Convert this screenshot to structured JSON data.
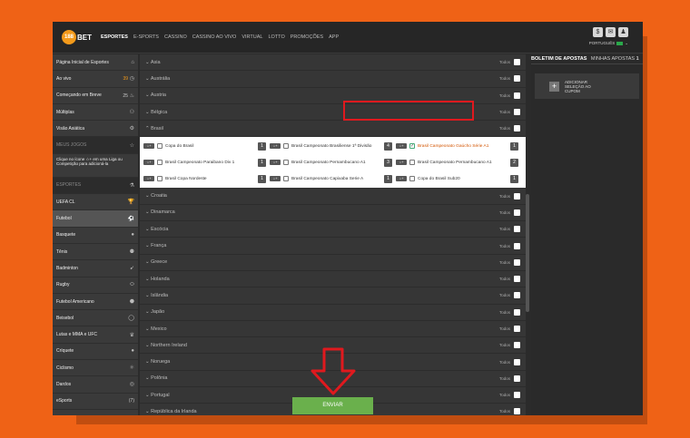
{
  "logo": {
    "number": "188",
    "word": "BET"
  },
  "nav": [
    "ESPORTES",
    "E-SPORTS",
    "CASSINO",
    "CASSINO AO VIVO",
    "VIRTUAL",
    "LOTTO",
    "PROMOÇÕES",
    "APP"
  ],
  "header": {
    "language": "PORTUGUÊS"
  },
  "sidebar": [
    {
      "label": "Página Inicial de Esportes",
      "count": "",
      "type": "item"
    },
    {
      "label": "Ao vivo",
      "count": "39",
      "type": "item",
      "orange": true
    },
    {
      "label": "Começando em Breve",
      "count": "25",
      "type": "item"
    },
    {
      "label": "Múltiplas",
      "count": "",
      "type": "item"
    },
    {
      "label": "Visão Asiática",
      "count": "",
      "type": "item"
    },
    {
      "label": "MEUS JOGOS",
      "count": "",
      "type": "hdr"
    },
    {
      "label": "Clique no ícone ☆+ em uma Liga ou Competição para adicioná-la",
      "count": "",
      "type": "tall"
    },
    {
      "label": "ESPORTES",
      "count": "",
      "type": "hdr"
    },
    {
      "label": "UEFA CL",
      "count": "",
      "type": "item"
    },
    {
      "label": "Futebol",
      "count": "",
      "type": "item",
      "hl": true
    },
    {
      "label": "Basquete",
      "count": "",
      "type": "item"
    },
    {
      "label": "Tênis",
      "count": "",
      "type": "item"
    },
    {
      "label": "Badminton",
      "count": "",
      "type": "item"
    },
    {
      "label": "Rugby",
      "count": "",
      "type": "item"
    },
    {
      "label": "Futebol Americano",
      "count": "",
      "type": "item"
    },
    {
      "label": "Beisebol",
      "count": "",
      "type": "item"
    },
    {
      "label": "Lutas e MMA e UFC",
      "count": "",
      "type": "item"
    },
    {
      "label": "Críquete",
      "count": "",
      "type": "item"
    },
    {
      "label": "Ciclismo",
      "count": "",
      "type": "item"
    },
    {
      "label": "Dardos",
      "count": "",
      "type": "item"
    },
    {
      "label": "eSports",
      "count": "(7)",
      "type": "item"
    }
  ],
  "countries_top": [
    "Asia",
    "Austrália",
    "Austria",
    "Bélgica",
    "Brasil"
  ],
  "countries_bottom": [
    "Croatia",
    "Dinamarca",
    "Escócia",
    "França",
    "Greece",
    "Holanda",
    "Islândia",
    "Japão",
    "Mexico",
    "Northern Ireland",
    "Noruega",
    "Polônia",
    "Portugal",
    "República da Irlanda"
  ],
  "todos_label": "Todos",
  "competitions": [
    {
      "name": "Copa do Brasil",
      "num": "1",
      "selected": false
    },
    {
      "name": "Brasil Campeonato Brasiliense 1ª Divisão",
      "num": "4",
      "selected": false
    },
    {
      "name": "Brasil Campeonato Gaúcho Série A1",
      "num": "1",
      "selected": true
    },
    {
      "name": "Brasil Campeonato Paraibano Div 1",
      "num": "1",
      "selected": false
    },
    {
      "name": "Brasil Campeonato Pernambucano A1",
      "num": "3",
      "selected": false
    },
    {
      "name": "Brasil Campeonato Pernambucano A1",
      "num": "2",
      "selected": false
    },
    {
      "name": "Brasil Copa Nordeste",
      "num": "1",
      "selected": false
    },
    {
      "name": "Brasil Campeonato Capixaba Serie A",
      "num": "1",
      "selected": false
    },
    {
      "name": "Copa do Brasil Sub20",
      "num": "1",
      "selected": false
    }
  ],
  "betslip": {
    "tab1": "BOLETIM DE APOSTAS",
    "tab2": "MINHAS APOSTAS",
    "tab2_count": "1",
    "coupon": "ADICIONAR SELEÇÃO AO CUPOM"
  },
  "submit_label": "ENVIAR",
  "colors": {
    "background": "#ef6216",
    "accent": "#f39a1b",
    "submit": "#6ab04c",
    "highlight_box": "#e0191e"
  }
}
